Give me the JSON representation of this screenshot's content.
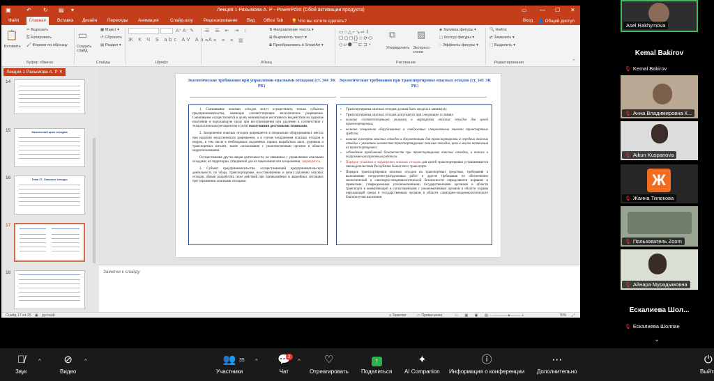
{
  "ppt": {
    "title": "Лекция 1 Рахымова А. Р - PowerPoint (Сбой активации продукта)",
    "tabs": [
      "Файл",
      "Главная",
      "Вставка",
      "Дизайн",
      "Переходы",
      "Анимация",
      "Слайд-шоу",
      "Рецензирование",
      "Вид",
      "Office Tab",
      "Что вы хотите сделать?"
    ],
    "account": {
      "signin": "Вход",
      "share": "Общий доступ"
    },
    "ribbon": {
      "clipboard": {
        "paste": "Вставить",
        "cut": "Вырезать",
        "copy": "Копировать",
        "format": "Формат по образцу",
        "label": "Буфер обмена"
      },
      "slides": {
        "new_slide": "Создать слайд",
        "layout": "Макет",
        "reset": "Сбросить",
        "section": "Раздел",
        "label": "Слайды"
      },
      "font": {
        "label": "Шрифт"
      },
      "paragraph": {
        "text_dir": "Направление текста",
        "align": "Выровнять текст",
        "smartart": "Преобразовать в SmartArt",
        "label": "Абзац"
      },
      "drawing": {
        "arrange": "Упорядочить",
        "quick_styles": "Экспресс-стили",
        "fill": "Заливка фигуры",
        "outline": "Контур фигуры",
        "effects": "Эффекты фигуры",
        "label": "Рисование"
      },
      "editing": {
        "find": "Найти",
        "replace": "Заменить",
        "select": "Выделить",
        "label": "Редактирование"
      }
    },
    "presentation_tab": "Лекция 1 Рахымова А. Р",
    "thumbnails": [
      {
        "num": "14",
        "title": ""
      },
      {
        "num": "15",
        "title": "Жизненный цикл отходов"
      },
      {
        "num": "16",
        "title": "Тема 17. Опасные отходы"
      },
      {
        "num": "17",
        "title": ""
      },
      {
        "num": "18",
        "title": ""
      }
    ],
    "slide": {
      "left_title": "Экологические требования при управлении опасными отходами (ст. 344 ЭК РК)",
      "right_title": "Экологические требования при транспортировке опасных отходов (ст. 345 ЭК РК)",
      "left": {
        "p1": "1. Смешивание опасных отходов могут осуществлять только субъекты предпринимательства, имеющие соответствующее экологическое разрешение. Смешивание осуществляется в целях минимизации негативного воздействия на здоровье населения и окружающую среду при восстановлении или удалении в соответствии с технологическим регламентом и (или)",
        "p1_bold": "наилучшими доступными техниками.",
        "p2": "2. Захоронение опасных отходов разрешается в специально оборудованных местах при наличии экологического разрешения, а в случае захоронения опасных отходов в недрах, в том числе в необходимых подземных горных выработках шахт, рудников и транспортных штолен, также согласования с уполномоченным органом в области недропользования.",
        "p3": "Осуществление других видов деятельности, не связанных с управлением опасными отходами, на территории, отведенной для их накопления или захоронения,",
        "p3_red": "запрещается.",
        "p4": "3. Субъект предпринимательства, осуществляющий предпринимательскую деятельность по сбору, транспортировке, восстановлению и (или) удалению опасных отходов, обязан разработать план действий при чрезвычайных и аварийных ситуациях при управлении опасными отходами."
      },
      "right": {
        "b1": "Транспортировка опасных отходов должна быть сведена к минимуму.",
        "b2": "Транспортировка опасных отходов допускается при следующих условиях:",
        "b3": "наличие соответствующей упаковки и маркировки опасных отходов для целей транспортировки;",
        "b4": "наличие специально оборудованных и снабженных специальными знаками транспортных средств;",
        "b5": "наличие паспорта опасных отходов и документации для транспортировки и передачи опасных отходов с указанием количества транспортируемых опасных отходов, цели и места назначения их транспортировки;",
        "b6": "соблюдение требований безопасности при транспортировке опасных отходов, а также к погрузочно-разгрузочным работам.",
        "b7_red": "Порядок упаковки и маркировки опасных отходов",
        "b7": "для целей транспортировки устанавливается законодательством Республики Казахстан о транспорте.",
        "b8": "Порядок транспортировки опасных отходов на транспортных средствах, требования к выполнению погрузочно-разгрузочных работ и другие требования по обеспечению экологической и санитарно-эпидемиологической безопасности определяются нормами и правилами, утверждаемыми уполномоченными государственными органами в области транспорта в коммуникаций и согласованными с уполномоченным органом в области охраны окружающей среды и государственным органом в области санитарно-эпидемиологического благополучия населения."
      }
    },
    "notes_placeholder": "Заметки к слайду",
    "status": {
      "slide": "Слайд 17 из 25",
      "lang": "русский",
      "notes": "Заметки",
      "comments": "Примечания",
      "zoom": "70%"
    }
  },
  "participants": [
    {
      "name": "Asel Rakhymova"
    },
    {
      "name": "Kemal Bakirov",
      "big": "Kemal Bakirov"
    },
    {
      "name": "Анна Владимировна К..."
    },
    {
      "name": "Aikun Kuspanova"
    },
    {
      "name": "Жанна Тилекова",
      "initial": "Ж"
    },
    {
      "name": "Пользователь Zoom"
    },
    {
      "name": "Айнара Мурадымовна"
    },
    {
      "name": "Ескалиева Шолпан",
      "big": "Ескалиева Шол..."
    }
  ],
  "toolbar": {
    "audio": "Звук",
    "video": "Видео",
    "participants": "Участники",
    "participants_count": "35",
    "chat": "Чат",
    "chat_badge": "2",
    "react": "Отреагировать",
    "share": "Поделиться",
    "companion": "AI Companion",
    "info": "Информация о конференции",
    "more": "Дополнительно",
    "leave": "Выйти"
  },
  "colors": {
    "ppt_accent": "#c43e1c",
    "slide_title": "#2e5aa8",
    "zoom_bg": "#000000",
    "share_green": "#2bb24c"
  }
}
